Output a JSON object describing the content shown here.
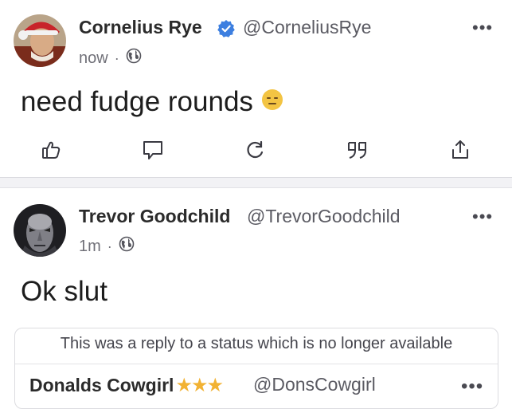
{
  "posts": [
    {
      "author_name": "Cornelius Rye",
      "verified": true,
      "handle": "@CorneliusRye",
      "time": "now",
      "separator": "·",
      "visibility_icon": "globe-icon",
      "more_label": "•••",
      "text": "need fudge rounds",
      "emoji": "😑",
      "actions": [
        "like-icon",
        "reply-icon",
        "boost-icon",
        "quote-icon",
        "share-icon"
      ]
    },
    {
      "author_name": "Trevor Goodchild",
      "handle": "@TrevorGoodchild",
      "time": "1m",
      "separator": "·",
      "visibility_icon": "globe-icon",
      "more_label": "•••",
      "text": "Ok slut",
      "quoted": {
        "note": "This was a reply to a status which is no longer available",
        "author_name": "Donalds Cowgirl",
        "stars": "★★★",
        "handle": "@DonsCowgirl",
        "more_label": "•••"
      }
    }
  ],
  "colors": {
    "verified_badge": "#3d7fe0",
    "emoji_face": "#f3c443",
    "stars": "#f2b233",
    "icon_stroke": "#3a3a42"
  }
}
